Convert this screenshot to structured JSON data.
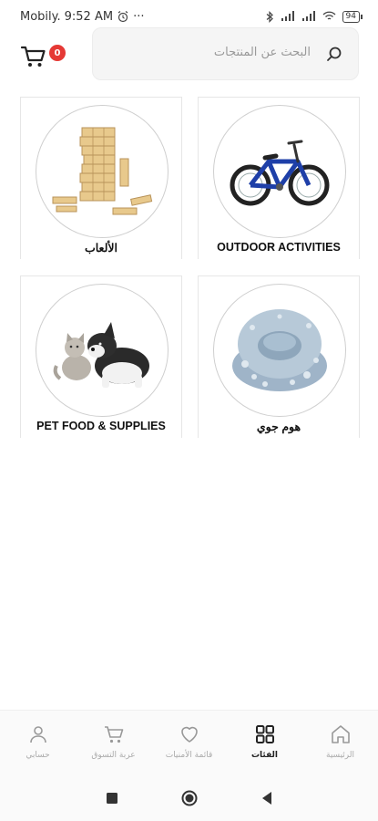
{
  "status_bar": {
    "carrier": "Mobily.",
    "time": "9:52 AM",
    "dots": "···",
    "battery": "94"
  },
  "header": {
    "cart_count": "0",
    "search_placeholder": "البحث عن المنتجات"
  },
  "categories": [
    {
      "label": "OUTDOOR ACTIVITIES",
      "image": "bicycle"
    },
    {
      "label": "الألعاب",
      "image": "wooden-block-tower"
    },
    {
      "label": "هوم جوي",
      "image": "inflatable-chair"
    },
    {
      "label": "PET FOOD & SUPPLIES",
      "image": "puppy-and-kitten"
    }
  ],
  "bottom_nav": {
    "items": [
      {
        "label": "الرئيسية",
        "icon": "home-icon"
      },
      {
        "label": "الفئات",
        "icon": "grid-icon",
        "active": true
      },
      {
        "label": "قائمة الأمنيات",
        "icon": "heart-icon"
      },
      {
        "label": "عربة التسوق",
        "icon": "cart-icon"
      },
      {
        "label": "حسابي",
        "icon": "person-icon"
      }
    ]
  },
  "colors": {
    "badge": "#e53935",
    "search_bg": "#f5f5f5",
    "border": "#e6e6e6"
  }
}
